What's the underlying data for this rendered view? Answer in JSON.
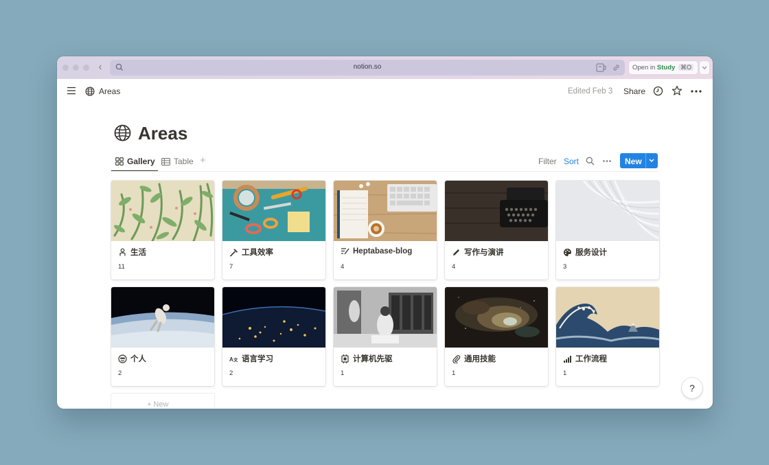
{
  "browser": {
    "url": "notion.so",
    "open_in_prefix": "Open in",
    "open_in_app": "Study",
    "open_in_shortcut": "⌘O"
  },
  "topbar": {
    "breadcrumb": "Areas",
    "edited": "Edited Feb 3",
    "share": "Share"
  },
  "page": {
    "title": "Areas",
    "icon": "globe-icon"
  },
  "views": {
    "tabs": [
      {
        "label": "Gallery",
        "icon": "gallery-icon",
        "active": true
      },
      {
        "label": "Table",
        "icon": "table-icon",
        "active": false
      }
    ],
    "filter": "Filter",
    "sort": "Sort",
    "new_label": "New"
  },
  "cards": [
    {
      "title": "生活",
      "count": "11",
      "icon": "person-icon"
    },
    {
      "title": "工具效率",
      "count": "7",
      "icon": "hammer-icon"
    },
    {
      "title": "Heptabase-blog",
      "count": "4",
      "icon": "notes-icon"
    },
    {
      "title": "写作与演讲",
      "count": "4",
      "icon": "pencil-icon"
    },
    {
      "title": "服务设计",
      "count": "3",
      "icon": "palette-icon"
    },
    {
      "title": "个人",
      "count": "2",
      "icon": "face-icon"
    },
    {
      "title": "语言学习",
      "count": "2",
      "icon": "translate-icon"
    },
    {
      "title": "计算机先驱",
      "count": "1",
      "icon": "chip-icon"
    },
    {
      "title": "通用技能",
      "count": "1",
      "icon": "paperclip-icon"
    },
    {
      "title": "工作流程",
      "count": "1",
      "icon": "signal-icon"
    }
  ],
  "new_card_label": "+ New",
  "help_label": "?",
  "colors": {
    "accent": "#2383e2",
    "text": "#37352f",
    "muted": "#787774"
  }
}
